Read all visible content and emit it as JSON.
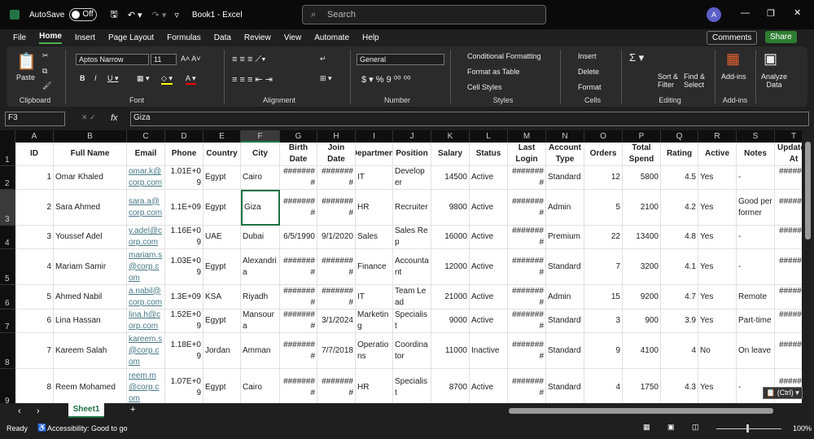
{
  "titlebar": {
    "autosave": "AutoSave",
    "toggle": "Off",
    "doc": "Book1 - Excel",
    "search": "Search",
    "avatar": "A"
  },
  "menu": {
    "items": [
      "File",
      "Home",
      "Insert",
      "Page Layout",
      "Formulas",
      "Data",
      "Review",
      "View",
      "Automate",
      "Help"
    ],
    "comments": "Comments",
    "share": "Share"
  },
  "ribbon": {
    "paste": "Paste",
    "clipboard": "Clipboard",
    "font_name": "Aptos Narrow",
    "font_size": "11",
    "font": "Font",
    "alignment": "Alignment",
    "number_format": "General",
    "number": "Number",
    "cond_format": "Conditional Formatting",
    "format_table": "Format as Table",
    "cell_styles": "Cell Styles",
    "styles": "Styles",
    "insert": "Insert",
    "delete": "Delete",
    "format": "Format",
    "cells": "Cells",
    "sort": "Sort & Filter",
    "find": "Find & Select",
    "editing": "Editing",
    "addins": "Add-ins",
    "addins_group": "Add-ins",
    "analyze": "Analyze Data"
  },
  "formula_bar": {
    "name_box": "F3",
    "fx": "fx",
    "value": "Giza"
  },
  "columns": [
    "A",
    "B",
    "C",
    "D",
    "E",
    "F",
    "G",
    "H",
    "I",
    "J",
    "K",
    "L",
    "M",
    "N",
    "O",
    "P",
    "Q",
    "R",
    "S",
    "T"
  ],
  "row_numbers": [
    "1",
    "2",
    "3",
    "4",
    "5",
    "6",
    "7",
    "8",
    "9"
  ],
  "headers": [
    "ID",
    "Full Name",
    "Email",
    "Phone",
    "Country",
    "City",
    "Birth Date",
    "Join Date",
    "Department",
    "Position",
    "Salary",
    "Status",
    "Last Login",
    "Account Type",
    "Orders",
    "Total Spend",
    "Rating",
    "Active",
    "Notes",
    "Updated At"
  ],
  "rows": [
    [
      "1",
      "Omar Khaled",
      "omar.k@corp.com",
      "1.01E+09",
      "Egypt",
      "Cairo",
      "########",
      "########",
      "IT",
      "Developer",
      "14500",
      "Active",
      "########",
      "Standard",
      "12",
      "5800",
      "4.5",
      "Yes",
      "-",
      "########"
    ],
    [
      "2",
      "Sara Ahmed",
      "sara.a@corp.com",
      "1.1E+09",
      "Egypt",
      "Giza",
      "########",
      "########",
      "HR",
      "Recruiter",
      "9800",
      "Active",
      "########",
      "Admin",
      "5",
      "2100",
      "4.2",
      "Yes",
      "Good performer",
      "########"
    ],
    [
      "3",
      "Youssef Adel",
      "y.adel@corp.com",
      "1.16E+09",
      "UAE",
      "Dubai",
      "6/5/1990",
      "9/1/2020",
      "Sales",
      "Sales Rep",
      "16000",
      "Active",
      "########",
      "Premium",
      "22",
      "13400",
      "4.8",
      "Yes",
      "-",
      "########"
    ],
    [
      "4",
      "Mariam Samir",
      "mariam.s@corp.com",
      "1.03E+09",
      "Egypt",
      "Alexandria",
      "########",
      "########",
      "Finance",
      "Accountant",
      "12000",
      "Active",
      "########",
      "Standard",
      "7",
      "3200",
      "4.1",
      "Yes",
      "-",
      "########"
    ],
    [
      "5",
      "Ahmed Nabil",
      "a.nabil@corp.com",
      "1.3E+09",
      "KSA",
      "Riyadh",
      "########",
      "########",
      "IT",
      "Team Lead",
      "21000",
      "Active",
      "########",
      "Admin",
      "15",
      "9200",
      "4.7",
      "Yes",
      "Remote",
      "########"
    ],
    [
      "6",
      "Lina Hassan",
      "lina.h@corp.com",
      "1.52E+09",
      "Egypt",
      "Mansoura",
      "########",
      "3/1/2024",
      "Marketing",
      "Specialist",
      "9000",
      "Active",
      "########",
      "Standard",
      "3",
      "900",
      "3.9",
      "Yes",
      "Part-time",
      "########"
    ],
    [
      "7",
      "Kareem Salah",
      "kareem.s@corp.com",
      "1.18E+09",
      "Jordan",
      "Amman",
      "########",
      "7/7/2018",
      "Operations",
      "Coordinator",
      "11000",
      "Inactive",
      "########",
      "Standard",
      "9",
      "4100",
      "4",
      "No",
      "On leave",
      "########"
    ],
    [
      "8",
      "Reem Mohamed",
      "reem.m@corp.com",
      "1.07E+09",
      "Egypt",
      "Cairo",
      "########",
      "########",
      "HR",
      "Specialist",
      "8700",
      "Active",
      "########",
      "Standard",
      "4",
      "1750",
      "4.3",
      "Yes",
      "-",
      "########"
    ]
  ],
  "sheet": {
    "tab": "Sheet1",
    "paste_options": "(Ctrl)"
  },
  "status": {
    "ready": "Ready",
    "accessibility": "Accessibility: Good to go",
    "zoom": "100%"
  },
  "colors": {
    "accent": "#217346",
    "share": "#2e7d32",
    "selection": "#1e7145"
  }
}
